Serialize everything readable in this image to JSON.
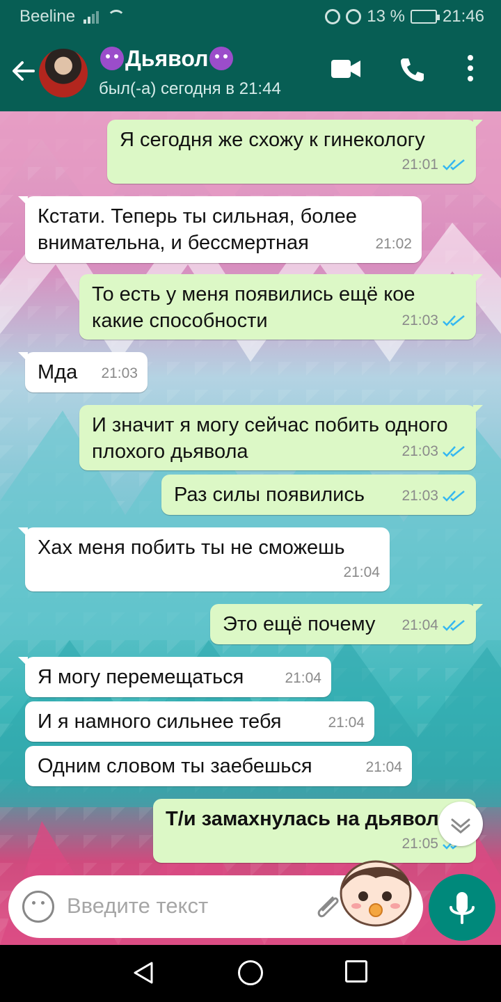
{
  "status_bar": {
    "carrier": "Beeline",
    "battery": "13 %",
    "time": "21:46"
  },
  "header": {
    "contact_name": "Дьявол",
    "last_seen": "был(-а) сегодня в 21:44",
    "icons": [
      "back-arrow-icon",
      "avatar",
      "video-call-icon",
      "phone-call-icon",
      "more-vert-icon"
    ]
  },
  "messages": [
    {
      "dir": "out",
      "text": "Я сегодня же схожу к гинекологу",
      "time": "21:01",
      "read": true
    },
    {
      "dir": "in",
      "text": "Кстати. Теперь ты сильная, более внимательна,  и бессмертная",
      "time": "21:02"
    },
    {
      "dir": "out",
      "text": "То есть у меня появились ещё кое какие способности",
      "time": "21:03",
      "read": true
    },
    {
      "dir": "in",
      "text": "Мда",
      "time": "21:03"
    },
    {
      "dir": "out",
      "text": "И значит я могу сейчас побить одного плохого дьявола",
      "time": "21:03",
      "read": true
    },
    {
      "dir": "out",
      "text": "Раз силы появились",
      "time": "21:03",
      "read": true
    },
    {
      "dir": "in",
      "text": "Хах меня побить ты не сможешь",
      "time": "21:04"
    },
    {
      "dir": "out",
      "text": "Это ещё почему",
      "time": "21:04",
      "read": true
    },
    {
      "dir": "in",
      "text": "Я могу перемещаться",
      "time": "21:04"
    },
    {
      "dir": "in",
      "text": "И я намного сильнее тебя",
      "time": "21:04"
    },
    {
      "dir": "in",
      "text": "Одним словом ты заебешься",
      "time": "21:04"
    },
    {
      "dir": "out",
      "text": "Т/и замахнулась на дьявола",
      "time": "21:05",
      "read": true,
      "bold": true
    }
  ],
  "composer": {
    "placeholder": "Введите текст"
  },
  "colors": {
    "header_bg": "#075e54",
    "outgoing_bubble": "#dcf8c6",
    "incoming_bubble": "#ffffff",
    "mic_button": "#00897b",
    "read_ticks": "#34b7f1"
  }
}
